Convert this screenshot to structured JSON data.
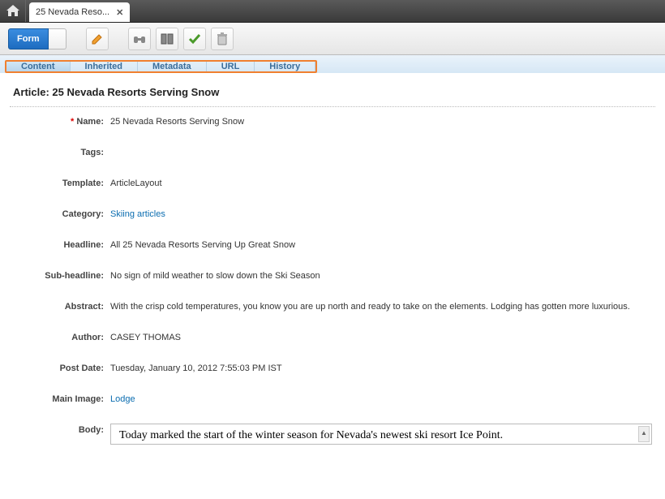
{
  "titlebar": {
    "tab_title": "25 Nevada Reso..."
  },
  "toolbar": {
    "form_label": "Form"
  },
  "subtabs": {
    "content": "Content",
    "inherited": "Inherited",
    "metadata": "Metadata",
    "url": "URL",
    "history": "History"
  },
  "heading": {
    "prefix": "Article:  ",
    "title": "25 Nevada Resorts Serving Snow"
  },
  "fields": {
    "name": {
      "label": "Name:",
      "value": "25 Nevada Resorts Serving Snow"
    },
    "tags": {
      "label": "Tags:",
      "value": ""
    },
    "template": {
      "label": "Template:",
      "value": "ArticleLayout"
    },
    "category": {
      "label": "Category:",
      "value": "Skiing articles"
    },
    "headline": {
      "label": "Headline:",
      "value": "All 25 Nevada Resorts Serving Up Great Snow"
    },
    "subheadline": {
      "label": "Sub-headline:",
      "value": "No sign of mild weather to slow down the Ski Season"
    },
    "abstract": {
      "label": "Abstract:",
      "value": "With the crisp cold temperatures, you know you are up north and ready to take on the elements. Lodging has gotten more luxurious."
    },
    "author": {
      "label": "Author:",
      "value": "CASEY THOMAS"
    },
    "postdate": {
      "label": "Post Date:",
      "value": "Tuesday, January 10, 2012 7:55:03 PM IST"
    },
    "mainimage": {
      "label": "Main Image:",
      "value": "Lodge"
    },
    "body": {
      "label": "Body:",
      "value": "Today marked the start of the winter season for Nevada's newest ski resort Ice Point."
    }
  }
}
